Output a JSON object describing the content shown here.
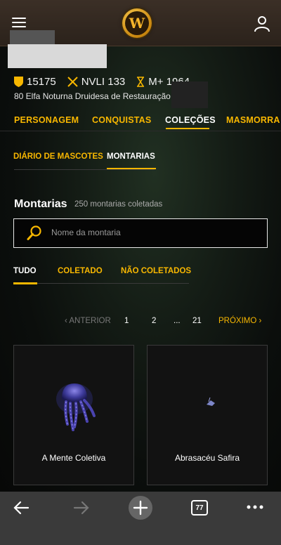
{
  "header": {
    "logo_text": "W"
  },
  "stats": {
    "achievement_points": "15175",
    "item_level": "NVLI 133",
    "mythic_plus": "M+ 1964"
  },
  "character": {
    "line": "80 Elfa Noturna Druidesa de Restauração"
  },
  "main_nav": {
    "tabs": [
      "PERSONAGEM",
      "CONQUISTAS",
      "COLEÇÕES",
      "MASMORRA"
    ],
    "active": "COLEÇÕES"
  },
  "sub_nav": {
    "tabs": [
      "DIÁRIO DE MASCOTES",
      "MONTARIAS"
    ],
    "active": "MONTARIAS"
  },
  "collection": {
    "title": "Montarias",
    "count": "250 montarias coletadas"
  },
  "search": {
    "placeholder": "Nome da montaria"
  },
  "filters": {
    "tabs": [
      "TUDO",
      "COLETADO",
      "NÃO COLETADOS"
    ],
    "active": "TUDO"
  },
  "pagination": {
    "prev": "‹ ANTERIOR",
    "pages": [
      "1",
      "2",
      "...",
      "21"
    ],
    "next": "PRÓXIMO ›"
  },
  "mounts": [
    {
      "name": "A Mente Coletiva"
    },
    {
      "name": "Abrasacéu Safira"
    }
  ],
  "browser": {
    "tab_count": "77"
  },
  "colors": {
    "accent": "#f8b700",
    "background": "#0b0e0c",
    "toolbar": "#3a3a3a"
  }
}
